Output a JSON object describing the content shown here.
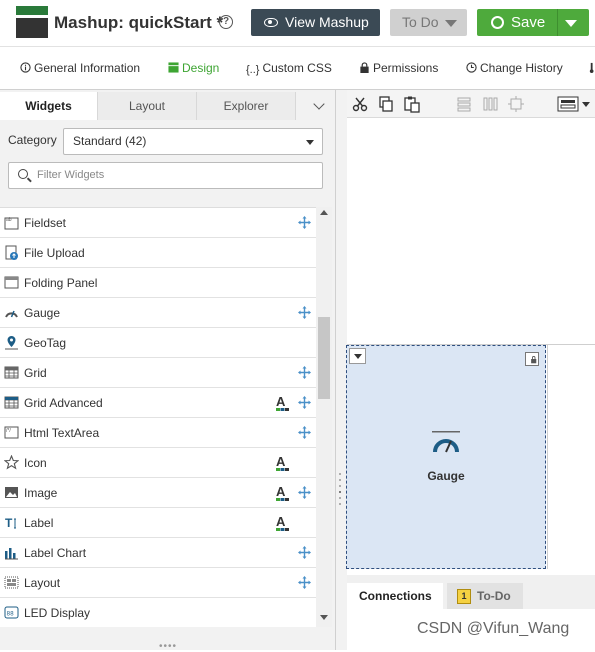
{
  "app": {
    "title": "Mashup: quickStart *",
    "help": "?",
    "view_label": "View Mashup",
    "todo_label": "To Do",
    "save_label": "Save"
  },
  "tabs": [
    {
      "label": "General Information",
      "icon": "info-icon"
    },
    {
      "label": "Design",
      "icon": "design-icon",
      "active": true
    },
    {
      "label": "Custom CSS",
      "icon": "css-icon"
    },
    {
      "label": "Permissions",
      "icon": "lock-icon"
    },
    {
      "label": "Change History",
      "icon": "history-icon"
    },
    {
      "label": "",
      "icon": "more-icon"
    }
  ],
  "panel": {
    "tabs": [
      "Widgets",
      "Layout",
      "Explorer"
    ],
    "category_label": "Category",
    "category_value": "Standard (42)",
    "filter_placeholder": "Filter Widgets"
  },
  "widgets": [
    {
      "label": "Fieldset",
      "icon": "fieldset-icon",
      "font": false,
      "move": true
    },
    {
      "label": "File Upload",
      "icon": "file-upload-icon",
      "font": false,
      "move": false
    },
    {
      "label": "Folding Panel",
      "icon": "folding-panel-icon",
      "font": false,
      "move": false
    },
    {
      "label": "Gauge",
      "icon": "gauge-icon",
      "font": false,
      "move": true
    },
    {
      "label": "GeoTag",
      "icon": "geotag-icon",
      "font": false,
      "move": false
    },
    {
      "label": "Grid",
      "icon": "grid-icon",
      "font": false,
      "move": true
    },
    {
      "label": "Grid Advanced",
      "icon": "grid-advanced-icon",
      "font": true,
      "move": true
    },
    {
      "label": "Html TextArea",
      "icon": "html-textarea-icon",
      "font": false,
      "move": true
    },
    {
      "label": "Icon",
      "icon": "star-icon",
      "font": true,
      "move": false
    },
    {
      "label": "Image",
      "icon": "image-icon",
      "font": true,
      "move": true
    },
    {
      "label": "Label",
      "icon": "label-icon",
      "font": true,
      "move": false
    },
    {
      "label": "Label Chart",
      "icon": "label-chart-icon",
      "font": false,
      "move": true
    },
    {
      "label": "Layout",
      "icon": "layout-icon",
      "font": false,
      "move": true
    },
    {
      "label": "LED Display",
      "icon": "led-display-icon",
      "font": false,
      "move": false
    }
  ],
  "canvas": {
    "gauge_label": "Gauge"
  },
  "bottom": {
    "connections": "Connections",
    "todo": "To-Do",
    "todo_count": "1"
  },
  "watermark": "CSDN @Vifun_Wang",
  "colors": {
    "accent": "#3ea533",
    "save": "#4eaa3c",
    "view": "#3b4a55",
    "selection": "#dbe6f4"
  }
}
